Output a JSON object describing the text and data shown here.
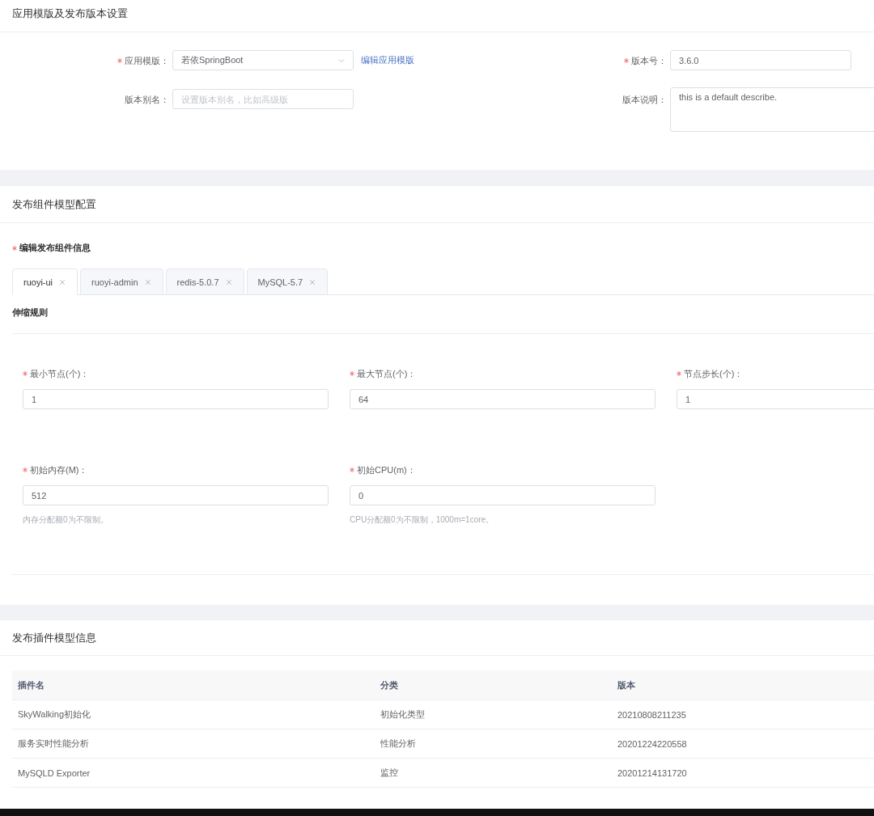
{
  "version_settings": {
    "title": "应用模版及发布版本设置",
    "fields": [
      {
        "kind": "select",
        "label": "应用模版：",
        "required": true,
        "value": "若依SpringBoot",
        "link": "编辑应用模版"
      },
      {
        "kind": "input",
        "label": "版本号：",
        "required": true,
        "value": "3.6.0"
      },
      {
        "kind": "input",
        "label": "版本别名：",
        "required": false,
        "placeholder": "设置版本别名，比如高级版"
      },
      {
        "kind": "textarea",
        "label": "版本说明：",
        "required": false,
        "value": "this is a default describe."
      }
    ]
  },
  "component_config": {
    "title": "发布组件模型配置",
    "edit_label": {
      "text": "编辑发布组件信息",
      "required": true
    },
    "tabs": [
      {
        "label": "ruoyi-ui",
        "selected": true
      },
      {
        "label": "ruoyi-admin",
        "selected": false
      },
      {
        "label": "redis-5.0.7",
        "selected": false
      },
      {
        "label": "MySQL-5.7",
        "selected": false
      }
    ],
    "subtitle": "伸缩规则",
    "fields": [
      {
        "label": "最小节点(个)：",
        "required": true,
        "value": "1"
      },
      {
        "label": "最大节点(个)：",
        "required": true,
        "value": "64"
      },
      {
        "label": "节点步长(个)：",
        "required": true,
        "value": "1"
      },
      {
        "label": "初始内存(M)：",
        "required": true,
        "value": "512",
        "hint": "内存分配额0为不限制。"
      },
      {
        "label": "初始CPU(m)：",
        "required": true,
        "value": "0",
        "hint": "CPU分配额0为不限制，1000m=1core。"
      }
    ]
  },
  "plugins": {
    "title": "发布插件模型信息",
    "table": {
      "columns": [
        "插件名",
        "分类",
        "版本"
      ],
      "rows": [
        [
          "SkyWalking初始化",
          "初始化类型",
          "20210808211235"
        ],
        [
          "服务实时性能分析",
          "性能分析",
          "20201224220558"
        ],
        [
          "MySQLD Exporter",
          "监控",
          "20201214131720"
        ]
      ]
    }
  }
}
